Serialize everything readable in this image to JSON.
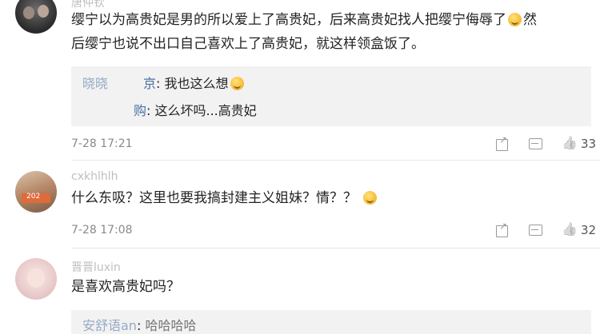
{
  "comments": [
    {
      "username": "唐仲钦",
      "lines": [
        "缨宁以为高贵妃是男的所以爱上了高贵妃，后来高贵妃找人把缨宁侮辱了",
        "后缨宁也说不出口自己喜欢上了高贵妃，就这样领盒饭了。"
      ],
      "line1_tail": "然",
      "replies": [
        {
          "name_faded": "晓晓",
          "name_tail": "京",
          "sep": ": ",
          "text": "我也这么想"
        },
        {
          "name_faded": "",
          "name_tail": "购",
          "sep": ": ",
          "text": "这么坏吗...高贵妃"
        }
      ],
      "time": "7-28 17:21",
      "likes": "33"
    },
    {
      "username": "cxkhlhlh",
      "avatar_badge": "202",
      "text": "什么东吸？这里也要我搞封建主义姐妹？情？？",
      "time": "7-28 17:08",
      "likes": "32"
    },
    {
      "username": "晋晋luxin",
      "text": "是喜欢高贵妃吗？",
      "replies": [
        {
          "name_faded": "安舒语an",
          "name_tail": "",
          "sep": ": ",
          "text": "哈哈哈哈"
        }
      ]
    }
  ],
  "icons": {
    "share": "share-icon",
    "comment": "comment-icon",
    "like": "thumbs-up-icon",
    "emoji": "smiley-emoji-icon"
  }
}
